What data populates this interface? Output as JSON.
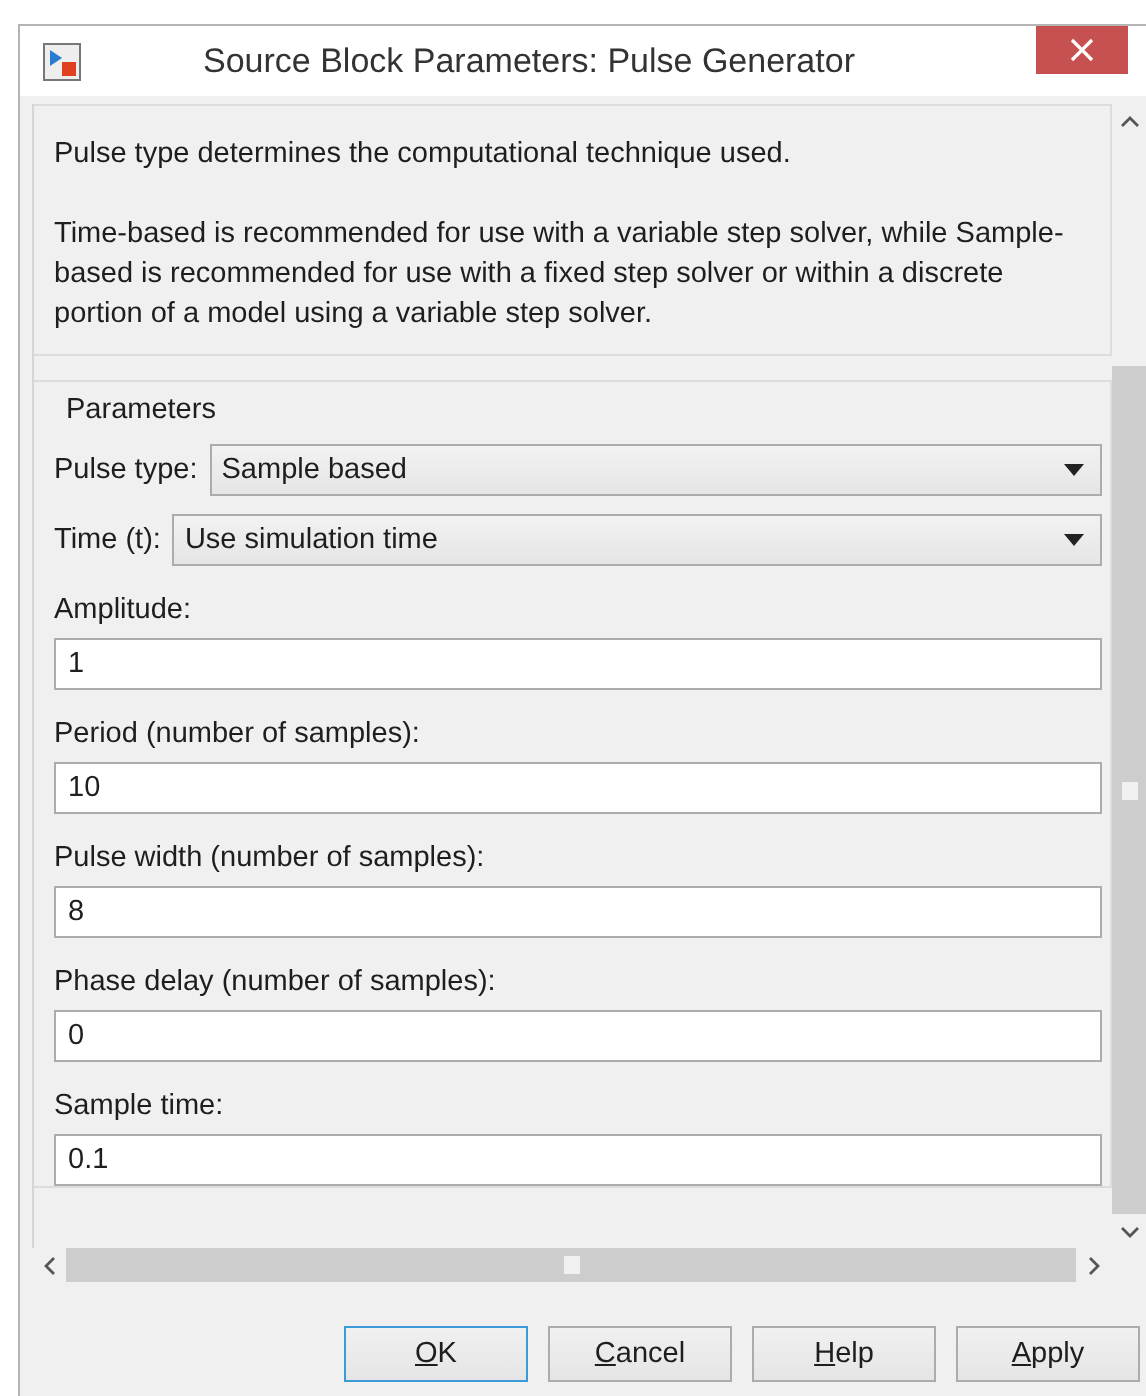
{
  "window": {
    "title": "Source Block Parameters: Pulse Generator"
  },
  "description": [
    "Pulse type determines the computational technique used.",
    "Time-based is recommended for use with a variable step solver, while Sample-based is recommended for use with a fixed step solver or within a discrete portion of a model using a variable step solver."
  ],
  "parameters": {
    "title": "Parameters",
    "items": [
      {
        "kind": "dropdown",
        "label": "Pulse type:",
        "value": "Sample based"
      },
      {
        "kind": "dropdown",
        "label": "Time (t):",
        "value": "Use simulation time"
      },
      {
        "kind": "text",
        "label": "Amplitude:",
        "value": "1"
      },
      {
        "kind": "text",
        "label": "Period (number of samples):",
        "value": "10"
      },
      {
        "kind": "text",
        "label": "Pulse width (number of samples):",
        "value": "8"
      },
      {
        "kind": "text",
        "label": "Phase delay (number of samples):",
        "value": "0"
      },
      {
        "kind": "text",
        "label": "Sample time:",
        "value": "0.1"
      }
    ]
  },
  "buttons": [
    {
      "label": "OK",
      "mnemonic": true,
      "focused": true
    },
    {
      "label": "Cancel",
      "mnemonic": true,
      "focused": false
    },
    {
      "label": "Help",
      "mnemonic": true,
      "focused": false
    },
    {
      "label": "Apply",
      "mnemonic": true,
      "focused": false
    }
  ]
}
